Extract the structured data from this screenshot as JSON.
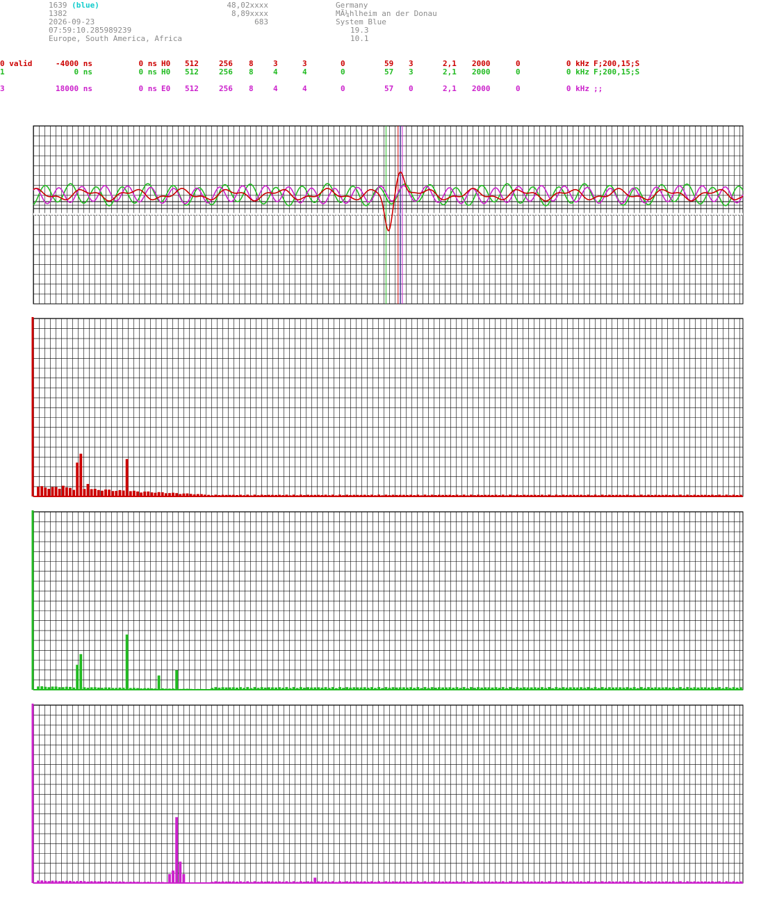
{
  "header": {
    "col1": [
      "1639",
      "1382",
      "2026-09-23",
      "07:59:10.285989239",
      "Europe, South America, Africa"
    ],
    "col1_tag": "(blue)",
    "col2": [
      "48,02xxxx",
      "8,89xxxx",
      "683"
    ],
    "col3": [
      "Germany",
      "MÃ¼hlheim an der Donau",
      "System Blue",
      "19.3",
      "10.1"
    ]
  },
  "channels": [
    {
      "id": "0 valid",
      "offset": "-4000 ns",
      "delay": "0 ns",
      "type": "H0",
      "a": "512",
      "b": "256",
      "c": "8",
      "d": "3",
      "e": "3",
      "f": "0",
      "g": "59",
      "h": "3",
      "i": "2,1",
      "j": "2000",
      "k": "0",
      "l": "0 kHz",
      "filter": "F;200,15;S",
      "color": "#cc0000"
    },
    {
      "id": "1",
      "offset": "0 ns",
      "delay": "0 ns",
      "type": "H0",
      "a": "512",
      "b": "256",
      "c": "8",
      "d": "4",
      "e": "4",
      "f": "0",
      "g": "57",
      "h": "3",
      "i": "2,1",
      "j": "2000",
      "k": "0",
      "l": "0 kHz",
      "filter": "F;200,15;S",
      "color": "#22bb22"
    },
    {
      "id": "3",
      "offset": "18000 ns",
      "delay": "0 ns",
      "type": "E0",
      "a": "512",
      "b": "256",
      "c": "8",
      "d": "4",
      "e": "4",
      "f": "0",
      "g": "57",
      "h": "0",
      "i": "2,1",
      "j": "2000",
      "k": "0",
      "l": "0 kHz",
      "filter": ";;",
      "color": "#cc22cc"
    }
  ],
  "chart_data": [
    {
      "type": "line",
      "series": [
        {
          "channel": "0",
          "color": "#cc0000"
        },
        {
          "channel": "1",
          "color": "#22bb22"
        },
        {
          "channel": "3",
          "color": "#cc22cc"
        }
      ],
      "markers": [
        {
          "color": "#22bb22",
          "x_fraction": 0.497
        },
        {
          "color": "#cc0000",
          "x_fraction": 0.514
        },
        {
          "color": "#4444cc",
          "x_fraction": 0.517
        },
        {
          "color": "#cc22cc",
          "x_fraction": 0.52
        }
      ],
      "grid": true
    },
    {
      "type": "bar",
      "channel": "0",
      "color": "#cc0000",
      "peaks": [
        {
          "bin": 13,
          "value": 0.24
        },
        {
          "bin": 12,
          "value": 0.19
        },
        {
          "bin": 26,
          "value": 0.21
        },
        {
          "bin": 15,
          "value": 0.07
        },
        {
          "bin": 8,
          "value": 0.06
        }
      ],
      "baseline": 0.06,
      "tail": 0.01,
      "grid": true
    },
    {
      "type": "bar",
      "channel": "1",
      "color": "#22bb22",
      "peaks": [
        {
          "bin": 26,
          "value": 0.31
        },
        {
          "bin": 13,
          "value": 0.2
        },
        {
          "bin": 12,
          "value": 0.14
        },
        {
          "bin": 40,
          "value": 0.11
        },
        {
          "bin": 35,
          "value": 0.08
        }
      ],
      "baseline": 0.02,
      "tail": 0.015,
      "grid": true
    },
    {
      "type": "bar",
      "channel": "3",
      "color": "#cc22cc",
      "peaks": [
        {
          "bin": 40,
          "value": 0.37
        },
        {
          "bin": 41,
          "value": 0.12
        },
        {
          "bin": 39,
          "value": 0.07
        },
        {
          "bin": 42,
          "value": 0.05
        },
        {
          "bin": 38,
          "value": 0.05
        },
        {
          "bin": 79,
          "value": 0.03
        }
      ],
      "baseline": 0.015,
      "tail": 0.01,
      "grid": true
    }
  ]
}
